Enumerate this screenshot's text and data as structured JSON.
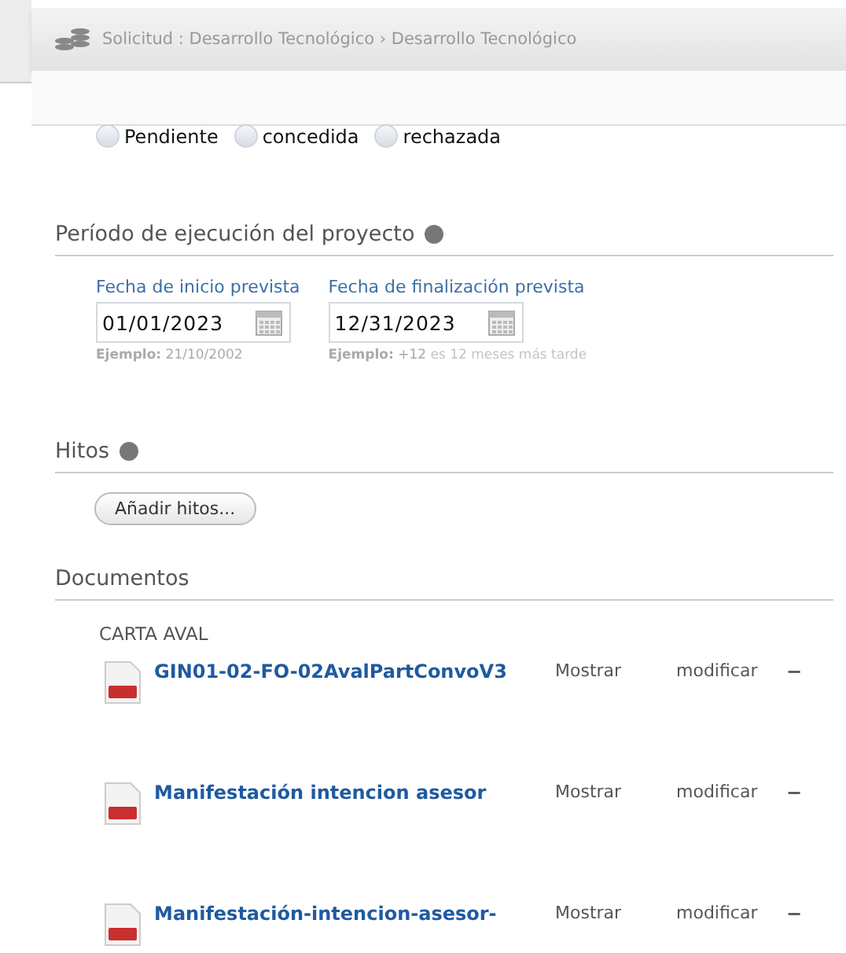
{
  "breadcrumb": "Solicitud : Desarrollo Tecnológico › Desarrollo Tecnológico",
  "status_options": [
    {
      "label": "Pendiente",
      "selected": false
    },
    {
      "label": "concedida",
      "selected": false
    },
    {
      "label": "rechazada",
      "selected": false
    }
  ],
  "period": {
    "title": "Período de ejecución del proyecto",
    "fields": [
      {
        "label": "Fecha de inicio prevista",
        "value": "01/01/2023",
        "hint_label": "Ejemplo:",
        "hint_value": "21/10/2002"
      },
      {
        "label": "Fecha de finalización prevista",
        "value": "12/31/2023",
        "hint_label": "Ejemplo:",
        "hint_value": "+12",
        "hint_extra": "es 12 meses más tarde"
      }
    ]
  },
  "milestones": {
    "title": "Hitos",
    "button": "Añadir hitos..."
  },
  "documents": {
    "title": "Documentos",
    "group": "CARTA AVAL",
    "items": [
      {
        "name": "GIN01-02-FO-02AvalPartConvoV3",
        "show": "Mostrar",
        "modify": "modificar",
        "remove": "−"
      },
      {
        "name": "Manifestación intencion asesor",
        "show": "Mostrar",
        "modify": "modificar",
        "remove": "−"
      },
      {
        "name": "Manifestación-intencion-asesor-",
        "show": "Mostrar",
        "modify": "modificar",
        "remove": "−"
      }
    ]
  }
}
